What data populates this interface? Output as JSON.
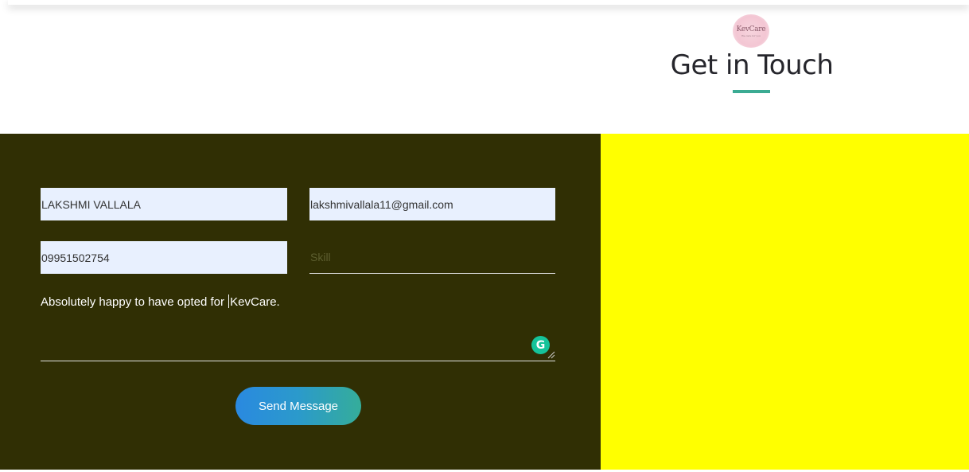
{
  "brand": {
    "logo_text": "KevCare",
    "logo_subtext": "We care for you"
  },
  "header": {
    "title": "Get in Touch"
  },
  "form": {
    "name_value": "LAKSHMI VALLALA",
    "email_value": "lakshmivallala11@gmail.com",
    "phone_value": "09951502754",
    "subject_placeholder": "Skill",
    "message_before_caret": "Absolutely happy to have opted for ",
    "message_after_caret": "KevCare.",
    "grammarly_icon_glyph": "G",
    "submit_label": "Send Message"
  },
  "colors": {
    "form_background": "#302f04",
    "map_background": "#ffff00",
    "accent_underline": "#3bab93",
    "button_gradient_start": "#2a89e0",
    "button_gradient_end": "#35ad9a",
    "input_background": "#e8f0fe"
  }
}
